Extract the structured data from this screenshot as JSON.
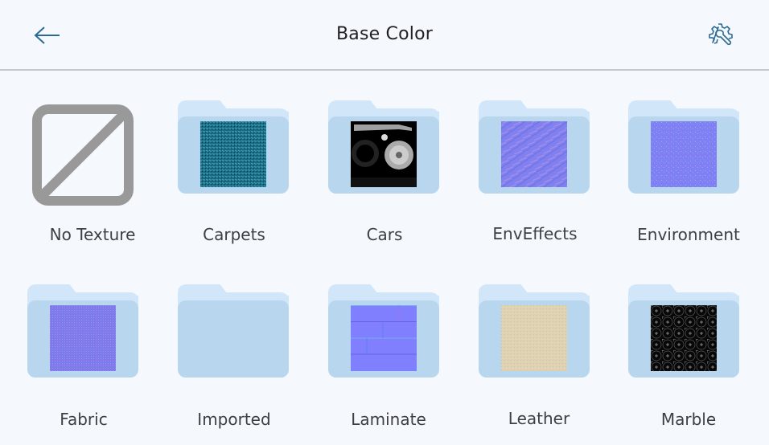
{
  "header": {
    "title": "Base Color",
    "back_icon": "arrow-left-icon",
    "settings_icon": "gear-wrench-icon"
  },
  "colors": {
    "background": "#f5f8fd",
    "accent": "#2c6a94",
    "folder_back": "#d1e6f8",
    "folder_front": "#b8d7ee",
    "no_texture_gray": "#999999",
    "label_text": "#3c3f44",
    "divider": "#c3c8ce"
  },
  "items": [
    {
      "label": "No Texture",
      "type": "none",
      "thumbnail": "no-texture-icon"
    },
    {
      "label": "Carpets",
      "type": "folder",
      "thumbnail": "teal-carpet-texture"
    },
    {
      "label": "Cars",
      "type": "folder",
      "thumbnail": "car-wheel-texture"
    },
    {
      "label": "EnvEffects",
      "type": "folder",
      "thumbnail": "normal-map-rough-texture"
    },
    {
      "label": "Environment",
      "type": "folder",
      "thumbnail": "normal-map-dots-texture"
    },
    {
      "label": "Fabric",
      "type": "folder",
      "thumbnail": "normal-map-fabric-texture"
    },
    {
      "label": "Imported",
      "type": "folder",
      "thumbnail": "empty"
    },
    {
      "label": "Laminate",
      "type": "folder",
      "thumbnail": "normal-map-planks-texture"
    },
    {
      "label": "Leather",
      "type": "folder",
      "thumbnail": "beige-leather-texture"
    },
    {
      "label": "Marble",
      "type": "folder",
      "thumbnail": "black-pattern-texture"
    }
  ]
}
